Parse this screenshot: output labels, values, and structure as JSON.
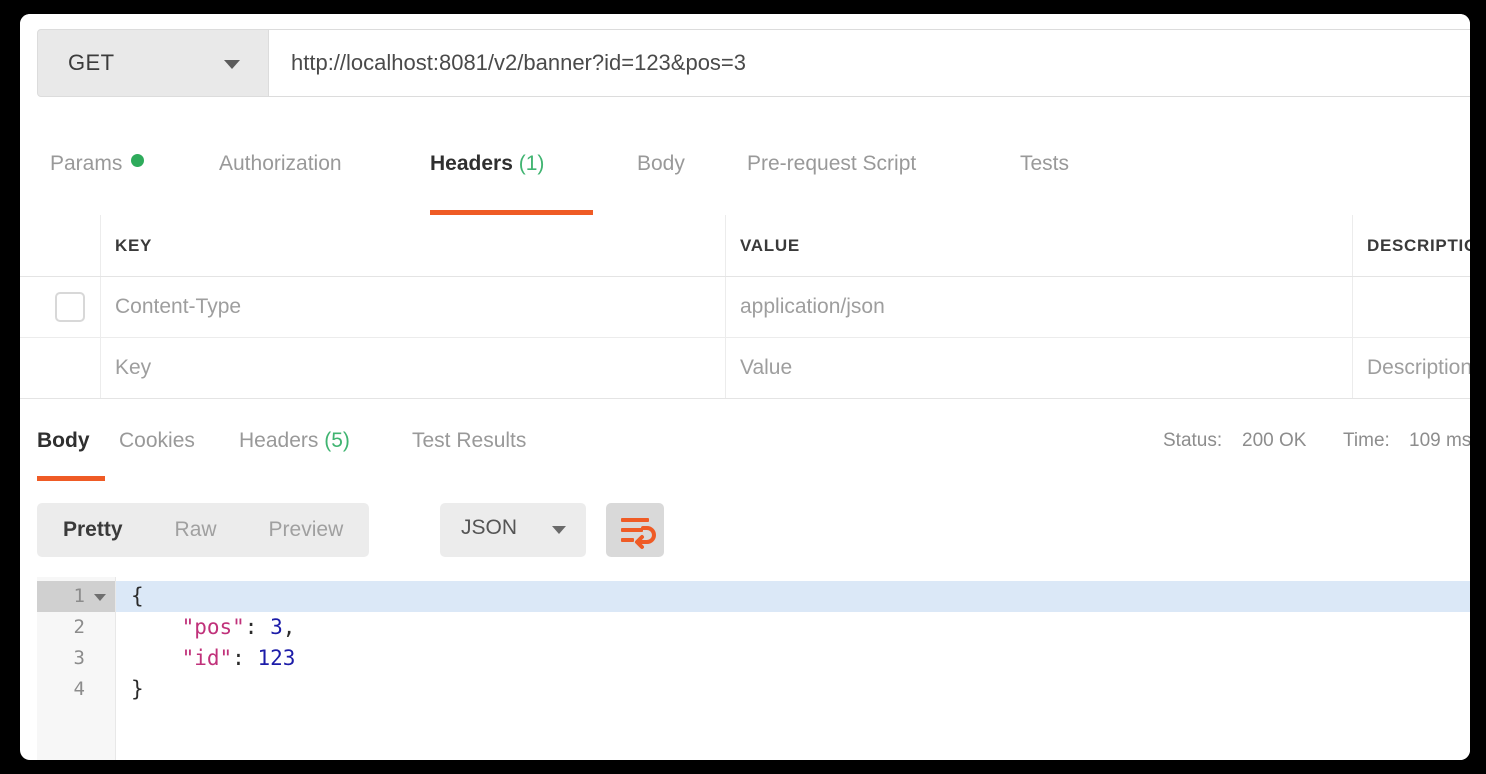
{
  "request": {
    "method": "GET",
    "url": "http://localhost:8081/v2/banner?id=123&pos=3",
    "tabs": [
      {
        "label": "Params",
        "dot": true,
        "active": false
      },
      {
        "label": "Authorization",
        "active": false
      },
      {
        "label": "Headers",
        "count": "(1)",
        "active": true
      },
      {
        "label": "Body",
        "active": false
      },
      {
        "label": "Pre-request Script",
        "active": false
      },
      {
        "label": "Tests",
        "active": false
      }
    ]
  },
  "headers_table": {
    "columns": [
      "KEY",
      "VALUE",
      "DESCRIPTION"
    ],
    "rows": [
      {
        "checkbox": true,
        "key": "Content-Type",
        "value": "application/json",
        "description": ""
      },
      {
        "checkbox": false,
        "key": "Key",
        "value": "Value",
        "description": "Description"
      }
    ]
  },
  "response": {
    "tabs": [
      {
        "label": "Body",
        "active": true
      },
      {
        "label": "Cookies",
        "active": false
      },
      {
        "label": "Headers",
        "count": "(5)",
        "active": false
      },
      {
        "label": "Test Results",
        "active": false
      }
    ],
    "status_label": "Status:",
    "status_value": "200 OK",
    "time_label": "Time:",
    "time_value": "109 ms",
    "view_modes": [
      {
        "label": "Pretty",
        "active": true
      },
      {
        "label": "Raw",
        "active": false
      },
      {
        "label": "Preview",
        "active": false
      }
    ],
    "format": "JSON",
    "wrap_icon": "word-wrap-icon",
    "code_lines": [
      {
        "num": "1",
        "foldable": true,
        "highlight": true,
        "tokens": [
          {
            "t": "{",
            "c": "jpunc"
          }
        ]
      },
      {
        "num": "2",
        "foldable": false,
        "highlight": false,
        "tokens": [
          {
            "t": "    \"pos\"",
            "c": "jkey"
          },
          {
            "t": ": ",
            "c": "jpunc"
          },
          {
            "t": "3",
            "c": "jnum"
          },
          {
            "t": ",",
            "c": "jpunc"
          }
        ]
      },
      {
        "num": "3",
        "foldable": false,
        "highlight": false,
        "tokens": [
          {
            "t": "    \"id\"",
            "c": "jkey"
          },
          {
            "t": ": ",
            "c": "jpunc"
          },
          {
            "t": "123",
            "c": "jnum"
          }
        ]
      },
      {
        "num": "4",
        "foldable": false,
        "highlight": false,
        "tokens": [
          {
            "t": "}",
            "c": "jpunc"
          }
        ]
      }
    ]
  },
  "colors": {
    "accent_orange": "#ef5b25",
    "success_green": "#3ec37e",
    "dot_green": "#2eab5b",
    "json_key": "#c0317a",
    "json_number": "#1c1ca8"
  }
}
